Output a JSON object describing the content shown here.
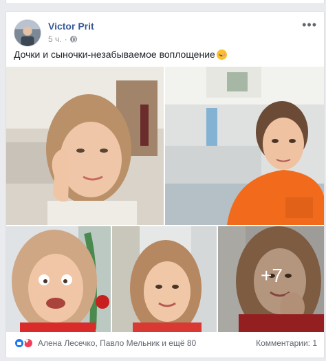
{
  "post": {
    "author": "Victor Prit",
    "time": "5 ч.",
    "privacy_icon": "globe-icon",
    "text": "Дочки и сыночки-незабываемое воплощение",
    "text_emoji": "smiling-face-with-hearts-icon"
  },
  "gallery": {
    "more_count": "+7"
  },
  "footer": {
    "reaction_icons": [
      "like-icon",
      "love-icon"
    ],
    "names": "Алена Лесечко, Павло Мельник и ещё 80",
    "comments": "Комментарии: 1"
  },
  "colors": {
    "author": "#385898",
    "like": "#1877f2",
    "love": "#f33e58",
    "muted": "#90949c"
  }
}
